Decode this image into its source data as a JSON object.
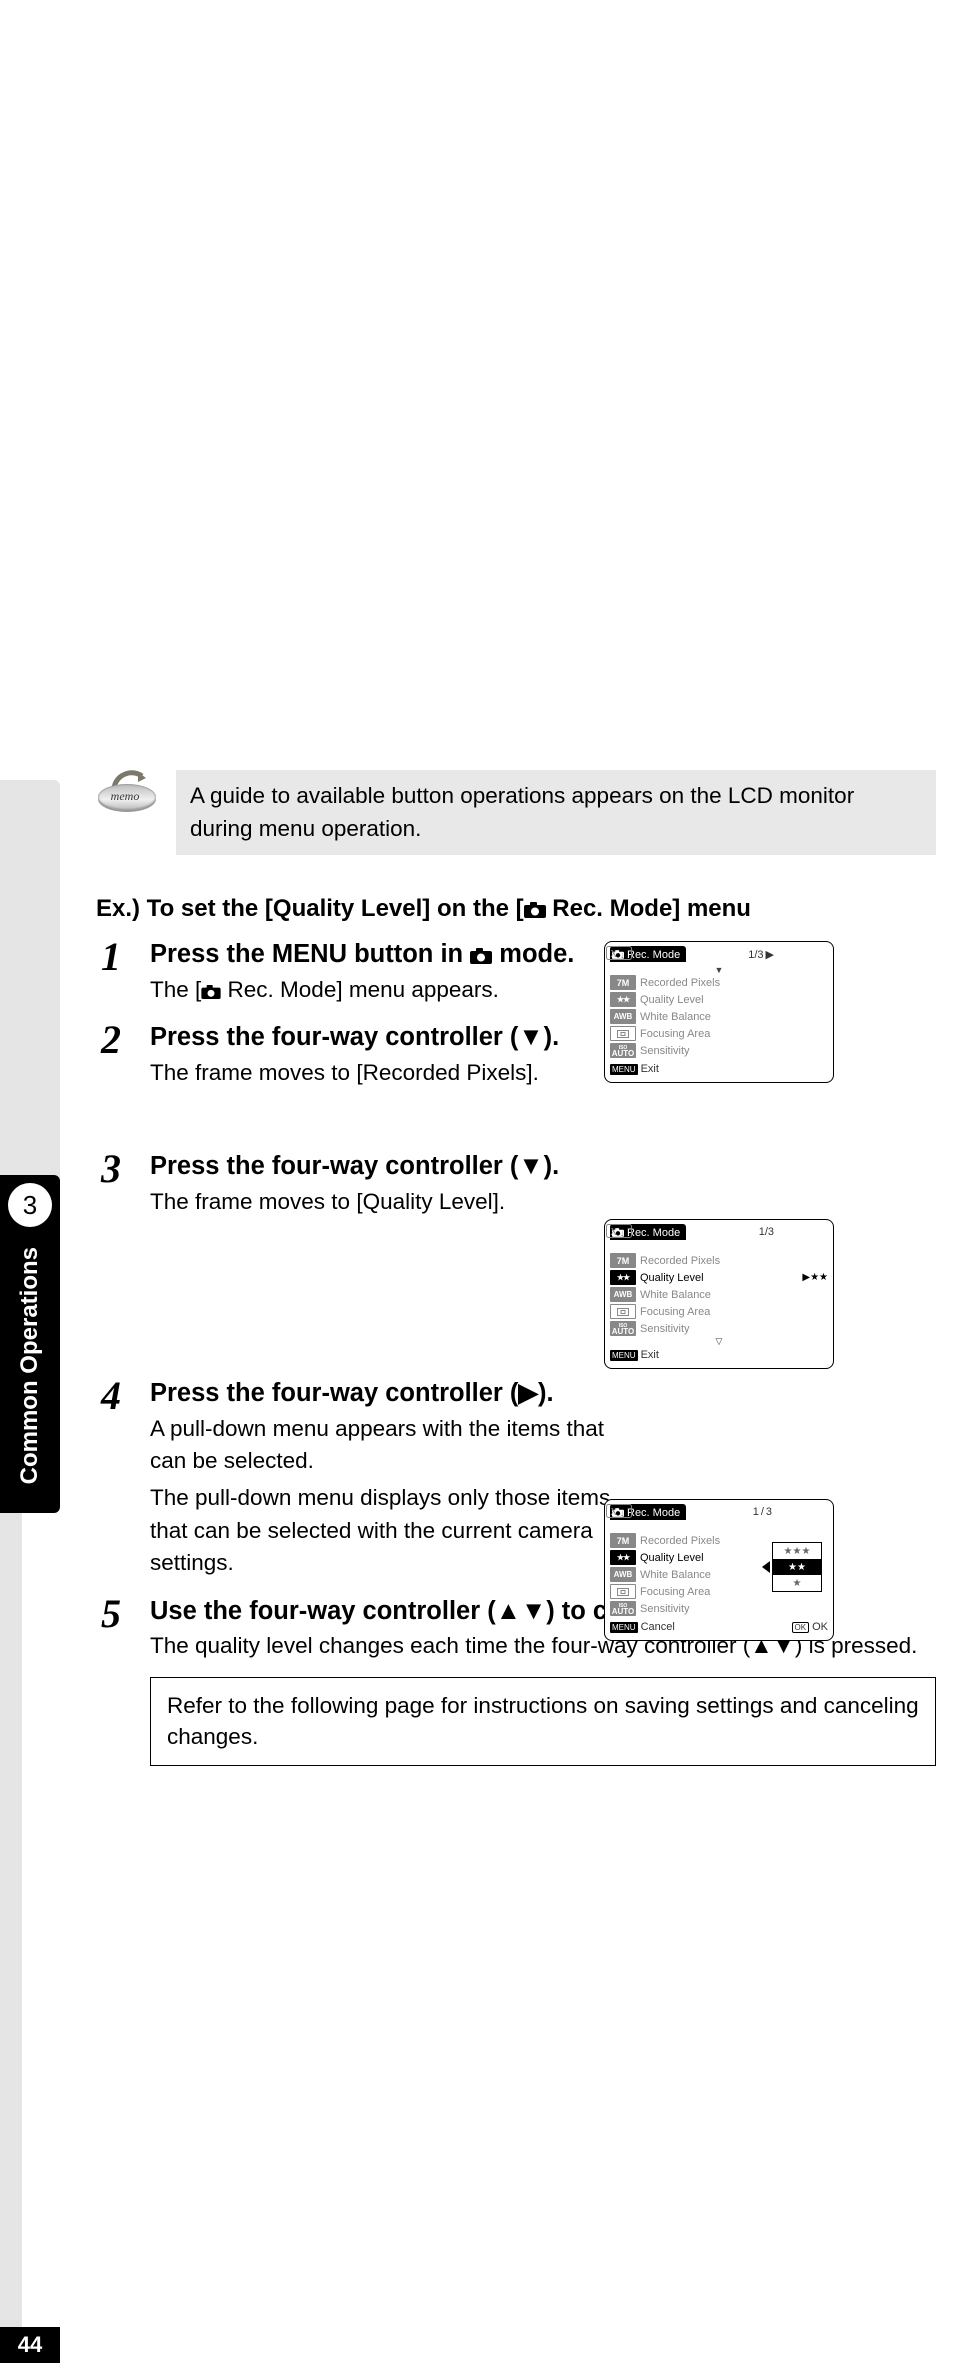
{
  "memo": {
    "label": "memo",
    "text": "A guide to available button operations appears on the LCD monitor during menu operation."
  },
  "sidebar": {
    "chapter_num": "3",
    "chapter_title": "Common Operations",
    "page_number": "44"
  },
  "heading_prefix": "Ex.) To set the [Quality Level] on the [",
  "heading_suffix": " Rec. Mode] menu",
  "steps": {
    "s1": {
      "n": "1",
      "title_a": "Press the ",
      "title_menu": "MENU",
      "title_b": " button in ",
      "title_c": " mode.",
      "desc_a": "The [",
      "desc_b": " Rec. Mode] menu appears."
    },
    "s2": {
      "n": "2",
      "title": "Press the four-way controller (▼).",
      "desc": "The frame moves to [Recorded Pixels]."
    },
    "s3": {
      "n": "3",
      "title": "Press the four-way controller (▼).",
      "desc": "The frame moves to [Quality Level]."
    },
    "s4": {
      "n": "4",
      "title": "Press the four-way controller (▶).",
      "desc1": "A pull-down menu appears with the items that can be selected.",
      "desc2": "The pull-down menu displays only those items that can be selected with the current camera settings."
    },
    "s5": {
      "n": "5",
      "title": "Use the four-way controller (▲▼) to change the setting.",
      "desc": "The quality level changes each time the four-way controller (▲▼) is pressed."
    }
  },
  "refer": "Refer to the following page for instructions on saving settings and canceling changes.",
  "lcd": {
    "tab": "Rec. Mode",
    "pager": "1/3",
    "rows": {
      "pixels": "Recorded Pixels",
      "quality": "Quality Level",
      "wb": "White Balance",
      "focus": "Focusing Area",
      "iso": "Sensitivity"
    },
    "chips": {
      "pixels": "7M",
      "quality": "★★",
      "wb": "AWB",
      "iso": "AUTO",
      "iso_pre": "ISO"
    },
    "exit": "Exit",
    "cancel": "Cancel",
    "ok": "OK",
    "menu": "MENU",
    "value_marker": "▶★★",
    "dropdown": {
      "o1": "★★★",
      "o2": "★★",
      "o3": "★"
    }
  }
}
